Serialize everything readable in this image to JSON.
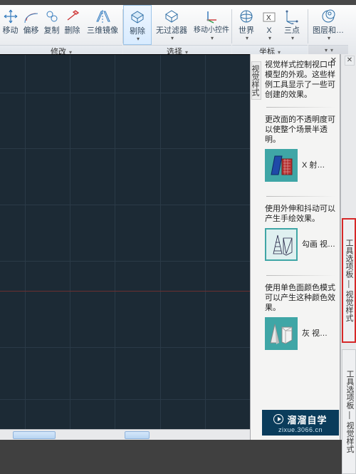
{
  "ribbon": {
    "groups": {
      "modify": {
        "title": "修改",
        "tools": {
          "move": "移动",
          "offset": "偏移",
          "copy": "复制",
          "delete": "删除",
          "mirror3d": "三维镜像"
        }
      },
      "select": {
        "title": "选择",
        "tools": {
          "erase": "剔除",
          "nofilter": "无过滤器",
          "movegizmo": "移动小控件"
        }
      },
      "coord": {
        "title": "坐标",
        "tools": {
          "world": "世界",
          "x": "X",
          "threepoints": "三点"
        }
      },
      "layers": {
        "title": "",
        "tools": {
          "layers": "图层和…"
        }
      }
    }
  },
  "vs_panel": {
    "vtitle": "视觉样式",
    "intro": "视觉样式控制视口中模型的外观。这些样例工具显示了一些可创建的效果。",
    "sections": [
      {
        "title": "更改面的不透明度可以使整个场景半透明。",
        "icon": "xray",
        "caption": "X 射…"
      },
      {
        "title": "使用外伸和抖动可以产生手绘效果。",
        "icon": "sketch",
        "caption": "勾画 视…"
      },
      {
        "title": "使用单色面颜色模式可以产生这种颜色效果。",
        "icon": "mono",
        "caption": "灰 视…"
      }
    ]
  },
  "side_tabs": {
    "a": "工具选项板 — 视觉样式",
    "b": "工具选项板 — 视觉样式"
  },
  "watermark": {
    "l1": "溜溜自学",
    "l2": "zixue.3066.cn"
  }
}
